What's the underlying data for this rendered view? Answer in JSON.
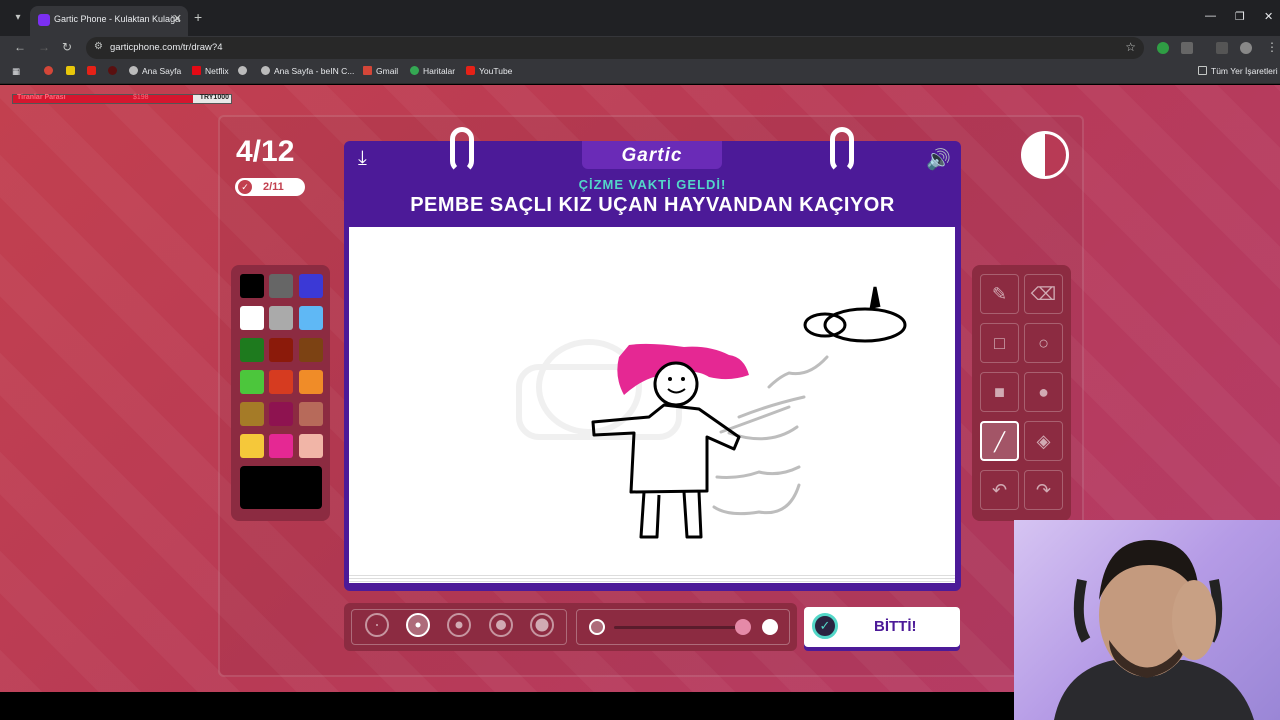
{
  "browser": {
    "tab_title": "Gartic Phone - Kulaktan Kulağa",
    "url": "garticphone.com/tr/draw?4",
    "bookmarks": [
      "Ana Sayfa",
      "Netflix",
      "Ana Sayfa - beIN C...",
      "Gmail",
      "Haritalar",
      "YouTube"
    ],
    "all_bookmarks": "Tüm Yer İşaretleri"
  },
  "overlay": {
    "donation_label": "Tiranlar Parası",
    "donation_value": "$198",
    "donation_goal": "TRY1000"
  },
  "game": {
    "round": "4/12",
    "players_done": "2/11",
    "logo": "Gartic",
    "subtitle": "ÇİZME VAKTİ GELDİ!",
    "prompt": "PEMBE SAÇLI KIZ UÇAN HAYVANDAN KAÇIYOR",
    "done_button": "BİTTİ!"
  },
  "palette": {
    "colors": [
      "#000000",
      "#666666",
      "#3b39d6",
      "#ffffff",
      "#aaaaaa",
      "#5fb8f5",
      "#1e7a1e",
      "#8b1a0a",
      "#7c4213",
      "#4cc63c",
      "#d63b20",
      "#f08c28",
      "#a57b27",
      "#8e1350",
      "#b76a5a",
      "#f5c83a",
      "#e52893",
      "#f1b5a7"
    ],
    "current": "#000000"
  },
  "tools": [
    "pencil-icon",
    "eraser-icon",
    "rectangle-outline-icon",
    "ellipse-outline-icon",
    "rectangle-fill-icon",
    "ellipse-fill-icon",
    "line-icon",
    "bucket-icon",
    "undo-icon",
    "redo-icon"
  ],
  "brush": {
    "sizes": 5,
    "selected_size": 2,
    "opacity": 0.9
  }
}
